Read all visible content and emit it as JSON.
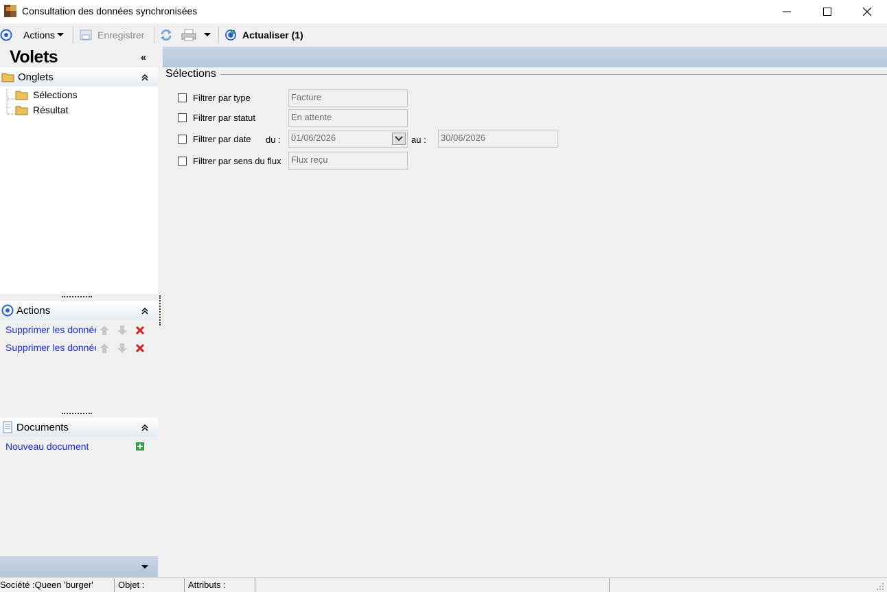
{
  "window": {
    "title": "Consultation des données synchronisées",
    "minimize": "minimize-icon",
    "maximize": "maximize-icon",
    "close": "close-icon"
  },
  "toolbar": {
    "actions_label": "Actions",
    "save_label": "Enregistrer",
    "refresh_label": "Actualiser (1)"
  },
  "left_panel": {
    "title": "Volets",
    "collapse_glyph": "«",
    "tabs_section": {
      "title": "Onglets",
      "items": [
        {
          "label": "Sélections"
        },
        {
          "label": "Résultat"
        }
      ]
    },
    "actions_section": {
      "title": "Actions",
      "items": [
        {
          "label": "Supprimer les données"
        },
        {
          "label": "Supprimer les données"
        }
      ]
    },
    "documents_section": {
      "title": "Documents",
      "items": [
        {
          "label": "Nouveau document"
        }
      ]
    },
    "section_toggle_glyph": "«"
  },
  "selections": {
    "legend": "Sélections",
    "filter_type": {
      "label": "Filtrer par type",
      "value": "Facture",
      "checked": false
    },
    "filter_status": {
      "label": "Filtrer par statut",
      "value": "En attente",
      "checked": false
    },
    "filter_date": {
      "label": "Filtrer par date",
      "from_label": "du :",
      "from_value": "01/06/2026",
      "to_label": "au :",
      "to_value": "30/06/2026",
      "checked": false
    },
    "filter_flow": {
      "label": "Filtrer par sens du flux",
      "value": "Flux reçu",
      "checked": false
    }
  },
  "statusbar": {
    "company": "Société :Queen 'burger'",
    "object": "Objet :",
    "attributes": "Attributs :"
  },
  "colors": {
    "link": "#1a2fcf",
    "header_band": "#c8d6e6",
    "delete_red": "#d42020"
  }
}
